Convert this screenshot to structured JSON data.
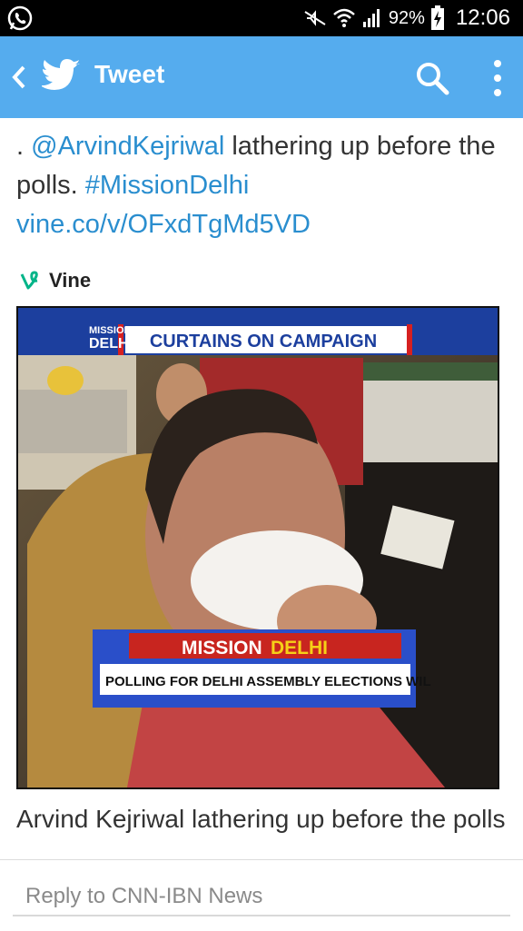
{
  "status_bar": {
    "battery": "92%",
    "time": "12:06"
  },
  "app_bar": {
    "title": "Tweet"
  },
  "tweet": {
    "lead": ". ",
    "mention": "@ArvindKejriwal",
    "text1": " lathering up before the polls. ",
    "hashtag": "#MissionDelhi",
    "sep": " ",
    "link": "vine.co/v/OFxdTgMd5VD"
  },
  "card": {
    "source_label": "Vine",
    "caption": "Arvind Kejriwal lathering up before the polls"
  },
  "video": {
    "logo_top": "MISSION",
    "logo_bottom": "DELHI",
    "headline": "CURTAINS ON CAMPAIGN",
    "lower_third_title_white": "MISSION",
    "lower_third_title_yellow": "DELHI",
    "ticker": "POLLING FOR DELHI ASSEMBLY ELECTIONS WIL"
  },
  "reply": {
    "placeholder": "Reply to CNN-IBN News"
  },
  "colors": {
    "twitter_blue": "#55acee",
    "link_blue": "#2a8ecf",
    "vine_green": "#00b488"
  }
}
